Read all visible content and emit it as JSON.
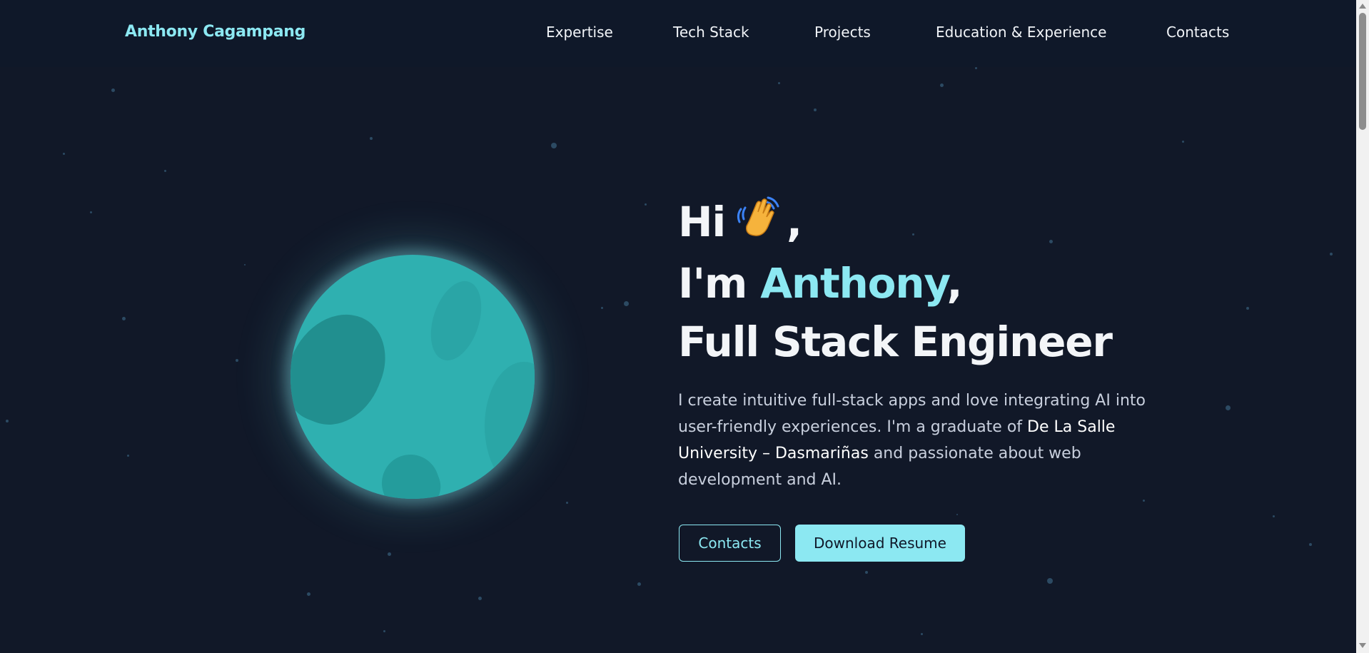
{
  "nav": {
    "brand": "Anthony Cagampang",
    "links": [
      "Expertise",
      "Tech Stack",
      "Projects",
      "Education & Experience",
      "Contacts"
    ]
  },
  "hero": {
    "greeting": "Hi",
    "wave_emoji": "waving-hand-icon",
    "comma": ",",
    "im": "I'm",
    "name": "Anthony",
    "name_comma": ",",
    "role": "Full Stack Engineer",
    "intro_part1": "I create intuitive full-stack apps and love integrating AI into user-friendly experiences. I'm a graduate of",
    "university": "De La Salle University – Dasmariñas",
    "intro_part2": "and passionate about web development and AI."
  },
  "buttons": {
    "contacts": "Contacts",
    "resume": "Download Resume"
  },
  "colors": {
    "background": "#111828",
    "accent": "#8ce8f2",
    "planet": "#2fb0b0",
    "text": "#f3f5f8"
  }
}
